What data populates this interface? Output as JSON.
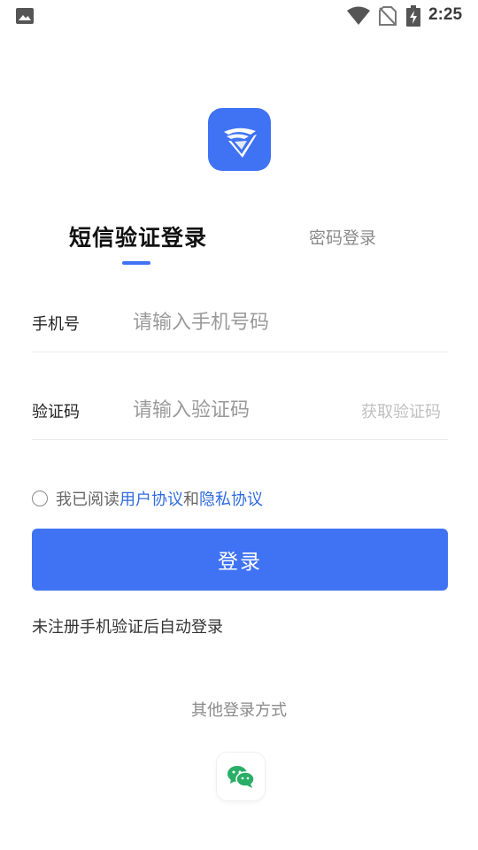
{
  "status_bar": {
    "time": "2:25",
    "icons": [
      "image-icon",
      "wifi-icon",
      "no-sim-icon",
      "battery-charging-icon"
    ]
  },
  "logo": {
    "icon": "app-logo-icon",
    "color": "#3f73f3"
  },
  "tabs": [
    {
      "label": "短信验证登录",
      "active": true
    },
    {
      "label": "密码登录",
      "active": false
    }
  ],
  "form": {
    "phone": {
      "label": "手机号",
      "placeholder": "请输入手机号码",
      "value": ""
    },
    "code": {
      "label": "验证码",
      "placeholder": "请输入验证码",
      "value": "",
      "get_code_label": "获取验证码"
    }
  },
  "agreement": {
    "checked": false,
    "prefix": "我已阅读",
    "user_agreement": "用户协议",
    "and": "和",
    "privacy_policy": "隐私协议"
  },
  "login_button": {
    "label": "登录"
  },
  "hint": "未注册手机验证后自动登录",
  "other_login": {
    "title": "其他登录方式",
    "methods": [
      "wechat-icon"
    ]
  },
  "colors": {
    "accent": "#3f73f3",
    "link": "#2f6be0",
    "wechat": "#2aae67"
  }
}
